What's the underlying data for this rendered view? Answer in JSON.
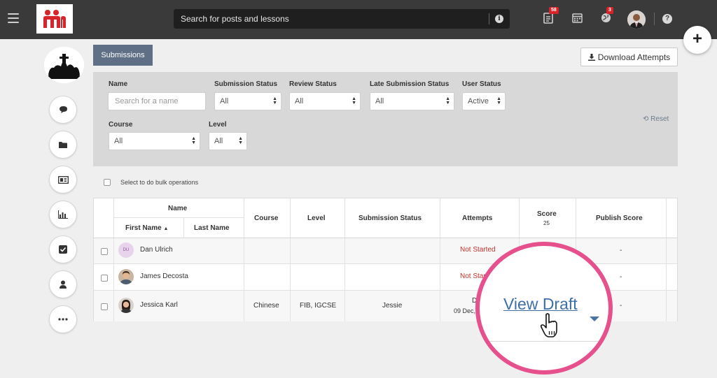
{
  "header": {
    "search_placeholder": "Search for posts and lessons",
    "notifications_count": "58",
    "alerts_count": "3"
  },
  "tabs": {
    "active": "Submissions"
  },
  "toolbar": {
    "download_label": "Download Attempts"
  },
  "filters": {
    "name_label": "Name",
    "name_placeholder": "Search for a name",
    "submission_status_label": "Submission Status",
    "submission_status_value": "All",
    "review_status_label": "Review Status",
    "review_status_value": "All",
    "late_submission_label": "Late Submission Status",
    "late_submission_value": "All",
    "user_status_label": "User Status",
    "user_status_value": "Active",
    "course_label": "Course",
    "course_value": "All",
    "level_label": "Level",
    "level_value": "All",
    "reset_label": "Reset"
  },
  "bulk": {
    "label": "Select to do bulk operations"
  },
  "table": {
    "headers": {
      "name": "Name",
      "first_name": "First Name",
      "last_name": "Last Name",
      "course": "Course",
      "level": "Level",
      "submission_status": "Submission Status",
      "attempts": "Attempts",
      "score": "Score",
      "score_max": "25",
      "publish_score": "Publish Score"
    },
    "rows": [
      {
        "initials": "DU",
        "name": "Dan Ulrich",
        "course": "",
        "level": "",
        "submission_status": "",
        "attempts": "Not Started",
        "publish": "-"
      },
      {
        "initials": "",
        "name": "James Decosta",
        "course": "",
        "level": "",
        "submission_status": "",
        "attempts": "Not Started",
        "publish": "-"
      },
      {
        "initials": "",
        "name": "Jessica Karl",
        "course": "Chinese",
        "level": "FIB, IGCSE",
        "submission_status": "Jessie",
        "attempts": "Draft",
        "attempts_date": "09 Dec, 9:",
        "publish": "-"
      }
    ]
  },
  "magnifier": {
    "link_label": "View Draft"
  },
  "colors": {
    "accent_tab": "#5f7086",
    "highlight_ring": "#e5508d",
    "link": "#3e6fa8",
    "status_red": "#c0312b"
  }
}
